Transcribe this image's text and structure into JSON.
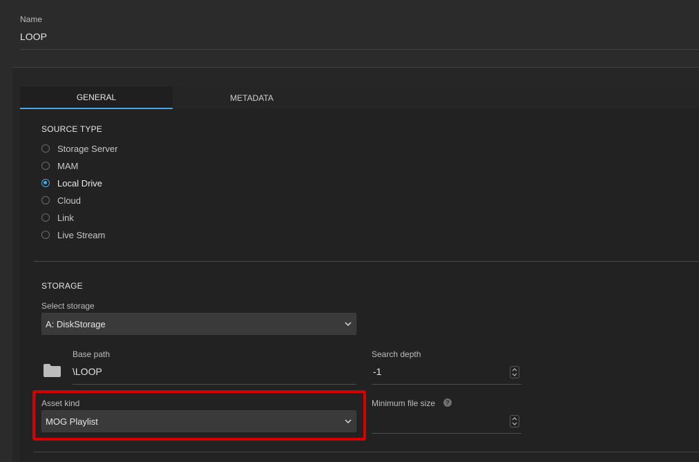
{
  "name_field": {
    "label": "Name",
    "value": "LOOP"
  },
  "tabs": [
    {
      "label": "GENERAL",
      "active": true
    },
    {
      "label": "METADATA",
      "active": false
    }
  ],
  "source_type": {
    "title": "SOURCE TYPE",
    "options": [
      {
        "label": "Storage Server",
        "checked": false
      },
      {
        "label": "MAM",
        "checked": false
      },
      {
        "label": "Local Drive",
        "checked": true
      },
      {
        "label": "Cloud",
        "checked": false
      },
      {
        "label": "Link",
        "checked": false
      },
      {
        "label": "Live Stream",
        "checked": false
      }
    ]
  },
  "storage": {
    "title": "STORAGE",
    "select_storage": {
      "label": "Select storage",
      "value": "A: DiskStorage"
    },
    "base_path": {
      "label": "Base path",
      "value": "\\LOOP"
    },
    "search_depth": {
      "label": "Search depth",
      "value": "-1"
    },
    "asset_kind": {
      "label": "Asset kind",
      "value": "MOG Playlist"
    },
    "min_file_size": {
      "label": "Minimum file size",
      "value": "",
      "help_glyph": "?"
    }
  },
  "icons": {
    "folder": "folder-icon",
    "chevron": "chevron-down-icon",
    "stepper": "stepper-icon",
    "help": "help-icon"
  },
  "colors": {
    "accent": "#4aa8e8",
    "highlight": "#d60000",
    "background": "#2b2b2b"
  }
}
